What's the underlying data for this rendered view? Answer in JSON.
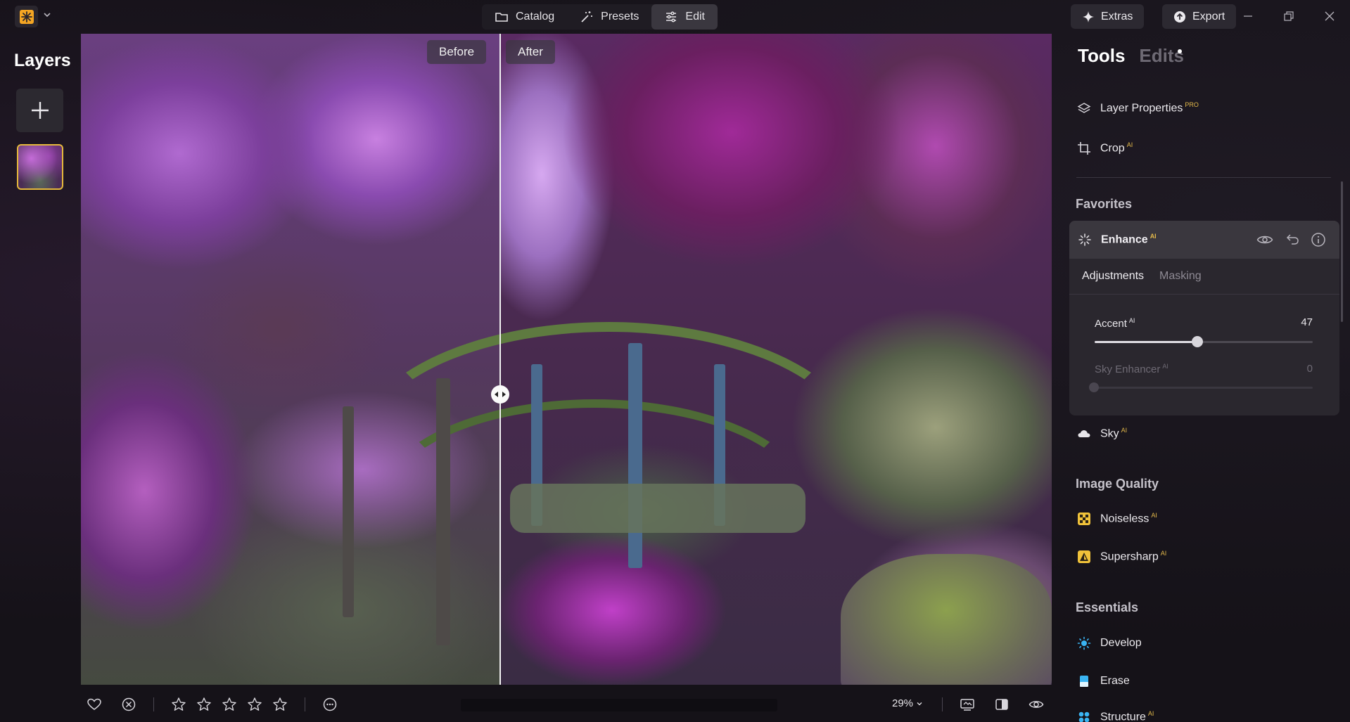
{
  "topbar": {
    "nav": [
      {
        "label": "Catalog",
        "icon": "folder-icon"
      },
      {
        "label": "Presets",
        "icon": "magic-wand-icon"
      },
      {
        "label": "Edit",
        "icon": "sliders-icon",
        "active": true
      }
    ],
    "extras_label": "Extras",
    "export_label": "Export"
  },
  "layers": {
    "title": "Layers"
  },
  "canvas": {
    "before_label": "Before",
    "after_label": "After"
  },
  "bottombar": {
    "zoom": "29%",
    "rating_stars": 5
  },
  "panel": {
    "tabs": {
      "tools": "Tools",
      "edits": "Edits"
    },
    "top_tools": [
      {
        "label": "Layer Properties",
        "tag": "PRO",
        "icon": "layers-icon"
      },
      {
        "label": "Crop",
        "tag": "AI",
        "icon": "crop-icon"
      }
    ],
    "favorites_title": "Favorites",
    "enhance": {
      "label": "Enhance",
      "tag": "AI",
      "subtabs": [
        "Adjustments",
        "Masking"
      ],
      "sliders": [
        {
          "label": "Accent",
          "tag": "AI",
          "value": "47",
          "fraction": 0.47,
          "enabled": true
        },
        {
          "label": "Sky Enhancer",
          "tag": "AI",
          "value": "0",
          "fraction": 0.0,
          "enabled": false
        }
      ]
    },
    "sky": {
      "label": "Sky",
      "tag": "AI"
    },
    "image_quality_title": "Image Quality",
    "image_quality": [
      {
        "label": "Noiseless",
        "tag": "AI",
        "icon": "noiseless-icon"
      },
      {
        "label": "Supersharp",
        "tag": "AI",
        "icon": "supersharp-icon"
      }
    ],
    "essentials_title": "Essentials",
    "essentials": [
      {
        "label": "Develop",
        "icon": "develop-icon"
      },
      {
        "label": "Erase",
        "icon": "erase-icon"
      },
      {
        "label": "Structure",
        "tag": "AI",
        "icon": "structure-icon"
      }
    ]
  },
  "colors": {
    "accent": "#f5a623",
    "thumb_border": "#e6b93c",
    "tag": "#e2b84a"
  }
}
